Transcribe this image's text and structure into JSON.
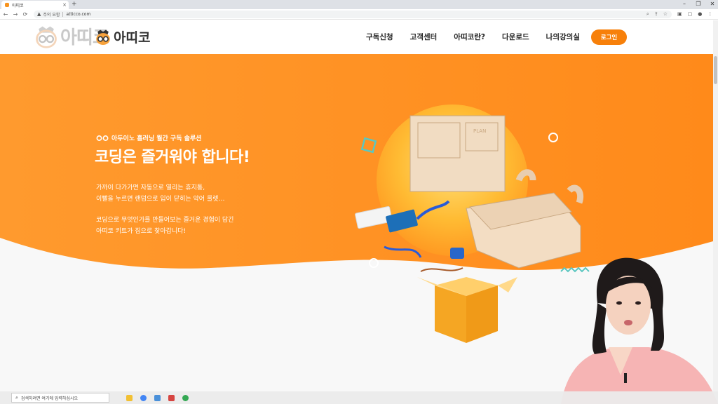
{
  "browser": {
    "tab_title": "아띠코",
    "tab_close": "×",
    "new_tab": "+",
    "win_min": "–",
    "win_max": "❐",
    "win_close": "✕",
    "nav_back": "←",
    "nav_forward": "→",
    "nav_reload": "⟳",
    "security_icon": "▲",
    "security_label": "주의 요함",
    "url": "atticco.com",
    "omnibox_icons": [
      "⌕",
      "⇪",
      "☆"
    ],
    "toolbar_icons": [
      "▣",
      "▢",
      "●",
      "⋮"
    ]
  },
  "site": {
    "logo_ghost_word": "아띠코",
    "logo_word": "아띠코",
    "nav": [
      "구독신청",
      "고객센터",
      "아띠코란?",
      "다운로드",
      "나의강의실"
    ],
    "login": "로그인",
    "brand_color": "#f7800a"
  },
  "hero": {
    "subtitle": "아두이노 홈러닝 월간 구독 솔루션",
    "title": "코딩은 즐거워야 합니다!",
    "desc_line1": "가까이 다가가면 자동으로 열리는 휴지통,",
    "desc_line2": "이빨을 누르면 랜덤으로 입이 닫히는 악어 룰렛…",
    "desc_line3": "코딩으로 무엇인가를 만들어보는 즐거운 경험이 담긴",
    "desc_line4": "아띠코 키트가 집으로 찾아갑니다!",
    "box_label": "PLAN"
  },
  "taskbar": {
    "search_icon": "⌕",
    "search_placeholder": "검색하려면 여기에 입력하십시오",
    "apps": [
      "file-explorer",
      "chrome",
      "app-blue",
      "app-red",
      "chrome-2"
    ]
  }
}
